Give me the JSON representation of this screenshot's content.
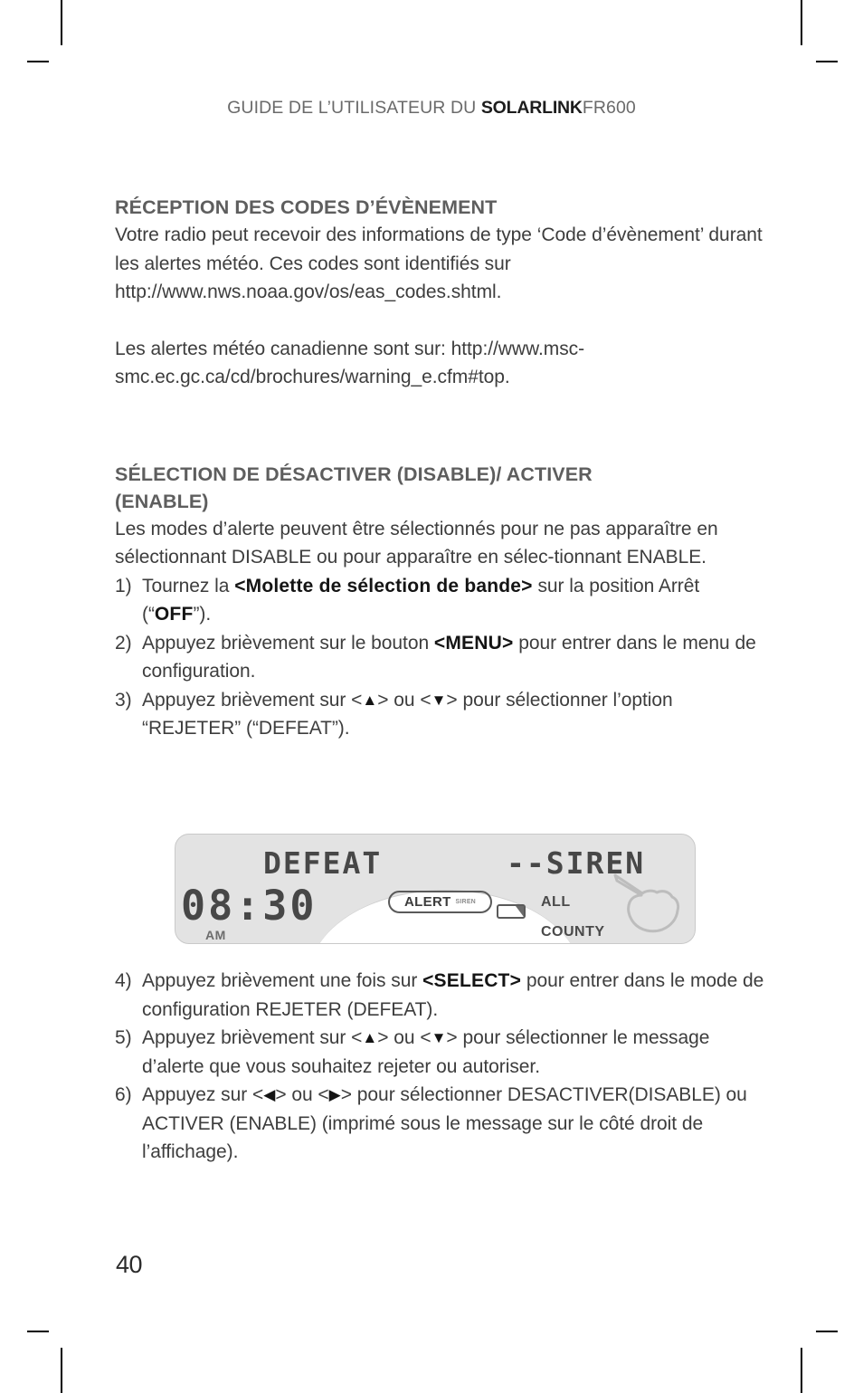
{
  "page": {
    "running_header": {
      "prefix": "GUIDE DE L’UTILISATEUR DU ",
      "brand": "SOLARLINK",
      "model": "FR600"
    },
    "page_number": "40"
  },
  "sections": [
    {
      "title": "RÉCEPTION DES CODES D’ÉVÈNEMENT",
      "paragraphs": [
        "Votre radio peut recevoir des informations de type ‘Code d’évènement’ durant les alertes météo. Ces codes sont identifiés sur http://www.nws.noaa.gov/os/eas_codes.shtml.",
        "Les alertes météo canadienne sont sur: http://www.msc-smc.ec.gc.ca/cd/brochures/warning_e.cfm#top."
      ]
    },
    {
      "title_line1": "SÉLECTION DE DÉSACTIVER (DISABLE)/ ACTIVER",
      "title_line2": "(ENABLE)",
      "intro": "Les modes d’alerte peuvent être sélectionnés pour ne pas apparaître en sélectionnant DISABLE ou pour apparaître en sélec-tionnant ENABLE."
    }
  ],
  "steps_before_figure": [
    {
      "num": "1)",
      "pre": "Tournez la ",
      "bold": "<Molette de sélection de bande>",
      "mid": " sur la position Arrêt (“",
      "bold2": "OFF",
      "post": "”)."
    },
    {
      "num": "2)",
      "pre": "Appuyez brièvement sur le bouton ",
      "bold": "<MENU>",
      "post": " pour entrer dans le menu de configuration."
    },
    {
      "num": "3)",
      "pre": "Appuyez brièvement sur ",
      "key_up": "▲",
      "mid": " ou ",
      "key_down": "▼",
      "post": " pour sélectionner l’option “REJETER” (“DEFEAT”)."
    }
  ],
  "steps_after_figure": [
    {
      "num": "4)",
      "pre": "Appuyez brièvement une fois sur ",
      "bold": "<SELECT>",
      "post": " pour entrer dans le mode de configuration REJETER (DEFEAT)."
    },
    {
      "num": "5)",
      "pre": "Appuyez brièvement sur ",
      "key_up": "▲",
      "mid": " ou ",
      "key_down": "▼",
      "post": " pour sélectionner le message d’alerte que vous souhaitez rejeter ou autoriser."
    },
    {
      "num": "6)",
      "pre": "Appuyez sur ",
      "key_left": "◀",
      "mid": " ou ",
      "key_right": "▶",
      "post": " pour sélectionner DESACTIVER(DISABLE) ou ACTIVER (ENABLE) (imprimé sous le message sur le côté droit de l’affichage)."
    }
  ],
  "lcd_figure": {
    "mode_text": "DEFEAT",
    "right_text": "--SIREN",
    "time": "08:30",
    "meridiem": "AM",
    "alert_badge": {
      "main": "ALERT",
      "sub": "SIREN"
    },
    "indicator_all": "ALL",
    "indicator_county": "COUNTY",
    "icons": {
      "battery": "battery-icon",
      "hand": "pointing-hand-icon"
    },
    "colors": {
      "panel": "#e3e3e3",
      "segment": "#474747",
      "label": "#4a4a4a"
    }
  }
}
